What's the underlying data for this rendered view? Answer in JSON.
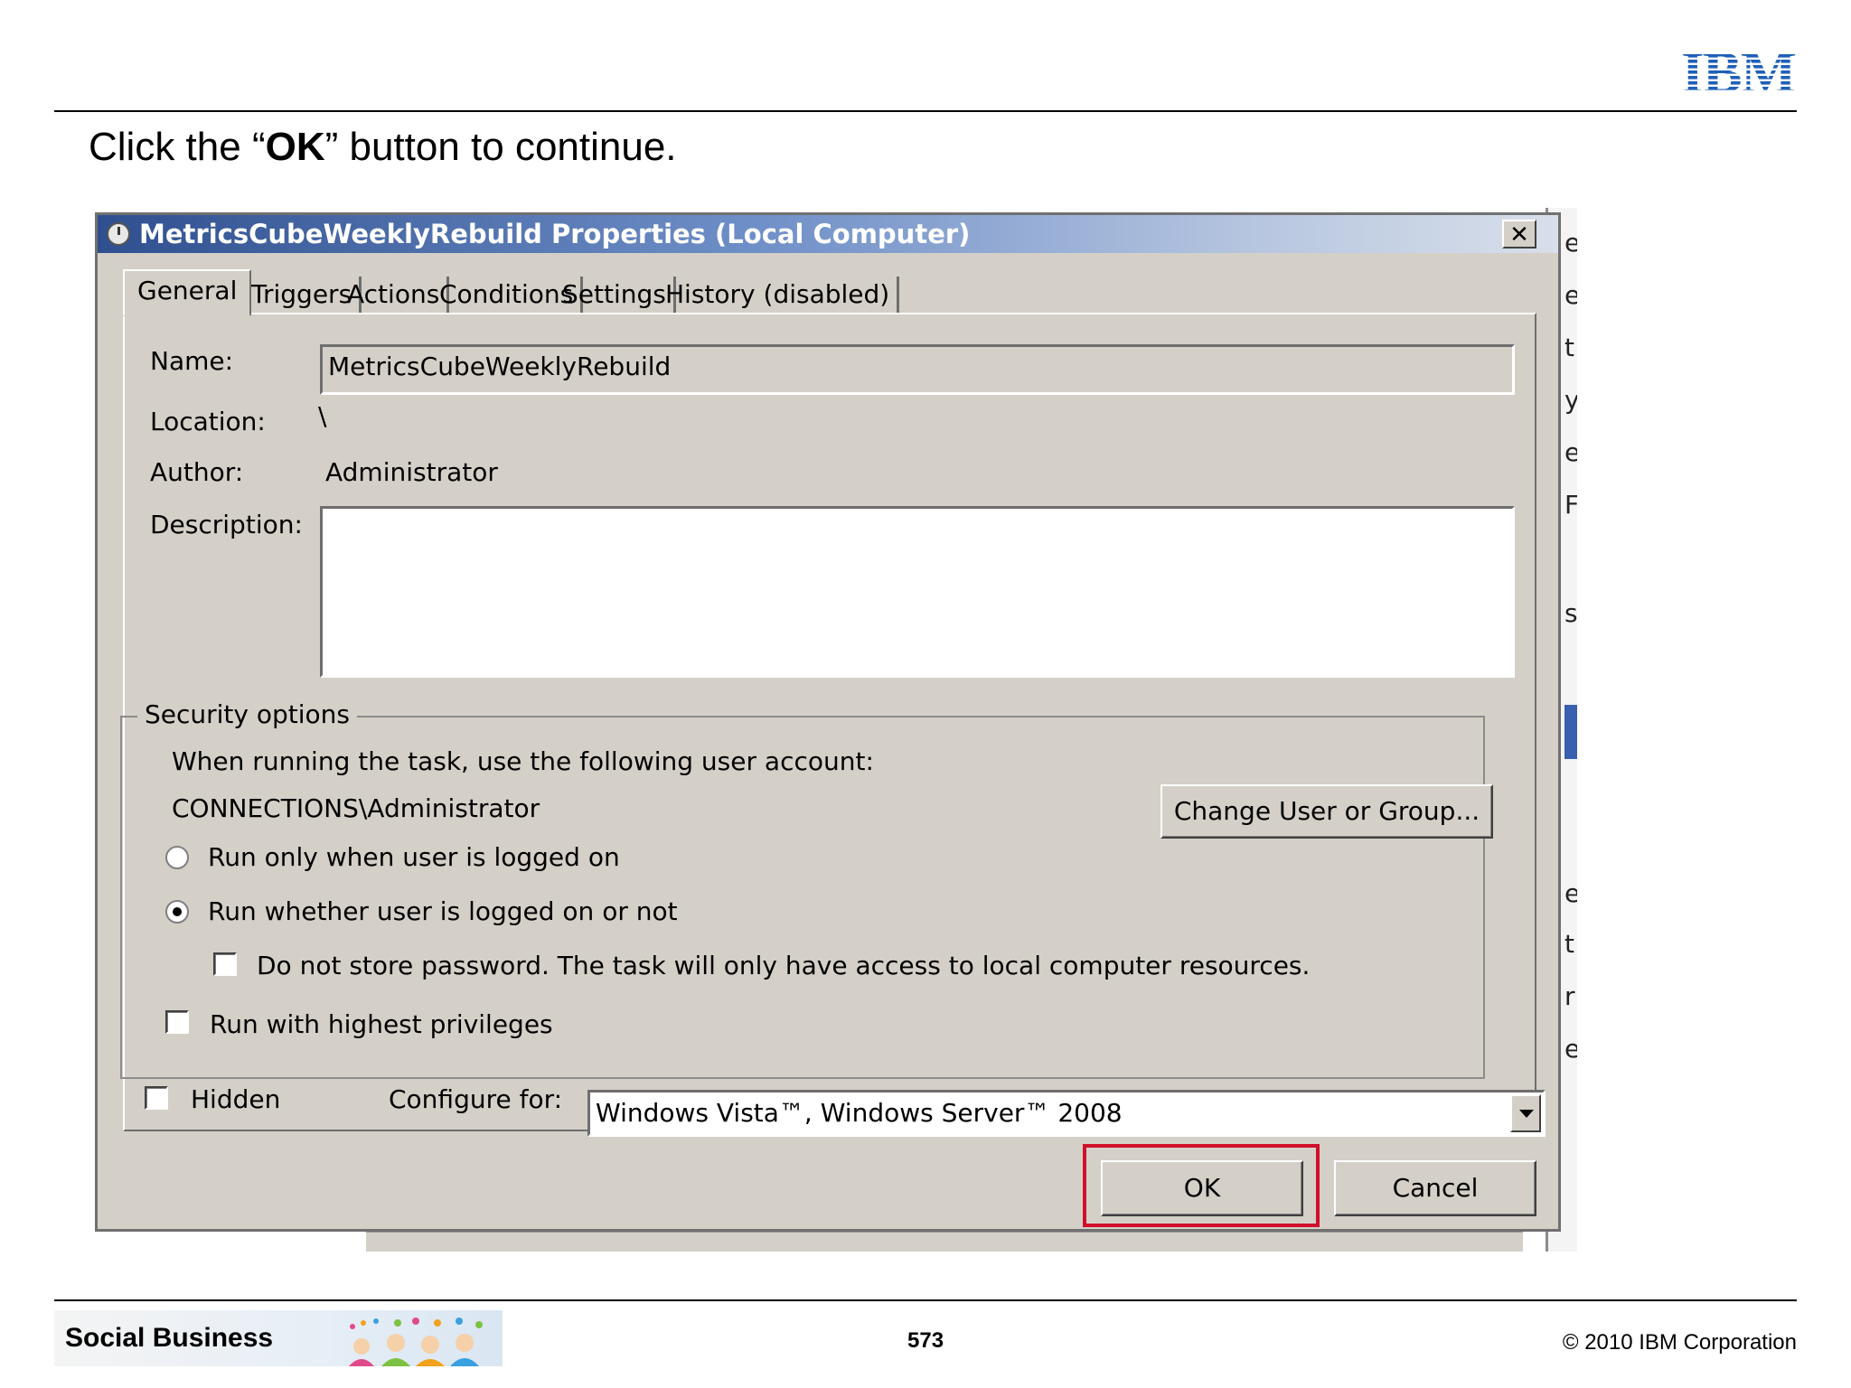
{
  "slide": {
    "logo_text": "IBM",
    "instruction_prefix": "Click the “",
    "instruction_bold": "OK",
    "instruction_suffix": "” button to continue."
  },
  "dialog": {
    "title": "MetricsCubeWeeklyRebuild Properties (Local Computer)",
    "close_label": "✕",
    "tabs": [
      "General",
      "Triggers",
      "Actions",
      "Conditions",
      "Settings",
      "History (disabled)"
    ],
    "active_tab": "General",
    "fields": {
      "name_label": "Name:",
      "name_value": "MetricsCubeWeeklyRebuild",
      "location_label": "Location:",
      "location_value": "\\",
      "author_label": "Author:",
      "author_value": "Administrator",
      "description_label": "Description:",
      "description_value": ""
    },
    "security": {
      "title": "Security options",
      "prompt": "When running the task, use the following user account:",
      "account": "CONNECTIONS\\Administrator",
      "change_button": "Change User or Group...",
      "radio_logged_on": "Run only when user is logged on",
      "radio_whether": "Run whether user is logged on or not",
      "selected_radio": "Run whether user is logged on or not",
      "no_store_password": "Do not store password.  The task will only have access to local computer resources.",
      "highest_privileges": "Run with highest privileges"
    },
    "hidden_label": "Hidden",
    "configure_label": "Configure for:",
    "configure_value": "Windows Vista™, Windows Server™ 2008",
    "ok_label": "OK",
    "cancel_label": "Cancel"
  },
  "background_window": {
    "edge_chars": [
      "e",
      "e",
      "t",
      "y",
      "e",
      "Fc",
      "sl",
      "e",
      "t",
      "r",
      "e"
    ]
  },
  "footer": {
    "banner_text": "Social Business",
    "page_number": "573",
    "copyright": "© 2010 IBM Corporation"
  },
  "colors": {
    "dialog_face": "#d4d0c8",
    "titlebar_start": "#2f4f8f",
    "highlight_red": "#d0102a",
    "ibm_blue": "#1f5fb8"
  }
}
